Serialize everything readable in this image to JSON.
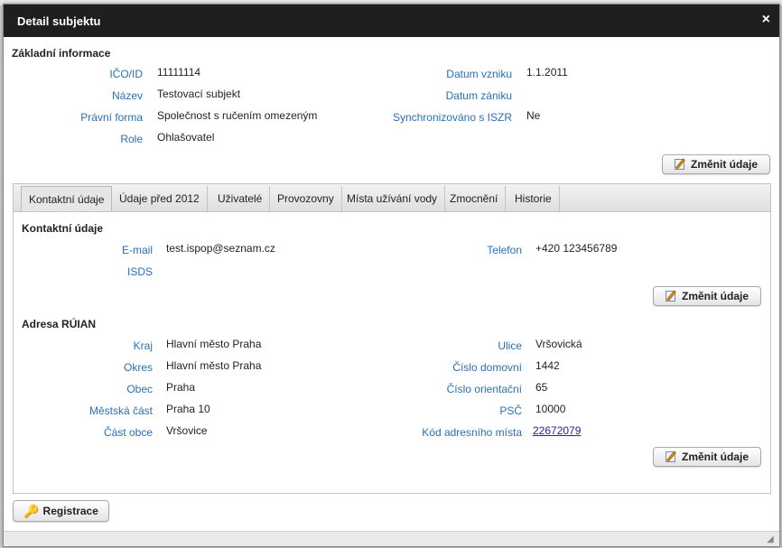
{
  "dialog": {
    "title": "Detail subjektu",
    "close_glyph": "×"
  },
  "basic": {
    "title": "Základní informace",
    "ico_label": "IČO/ID",
    "ico_value": "11111114",
    "name_label": "Název",
    "name_value": "Testovací subjekt",
    "form_label": "Právní forma",
    "form_value": "Společnost s ručením omezeným",
    "role_label": "Role",
    "role_value": "Ohlašovatel",
    "created_label": "Datum vzniku",
    "created_value": "1.1.2011",
    "ended_label": "Datum zániku",
    "ended_value": "",
    "sync_label": "Synchronizováno s ISZR",
    "sync_value": "Ne",
    "edit_button": "Změnit údaje"
  },
  "tabs": [
    {
      "label": "Kontaktní údaje",
      "active": true
    },
    {
      "label": "Údaje před 2012"
    },
    {
      "label": "Uživatelé"
    },
    {
      "label": "Provozovny"
    },
    {
      "label": "Místa užívání vody"
    },
    {
      "label": "Zmocnění"
    },
    {
      "label": "Historie"
    }
  ],
  "contact": {
    "title": "Kontaktní údaje",
    "email_label": "E-mail",
    "email_value": "test.ispop@seznam.cz",
    "isds_label": "ISDS",
    "isds_value": "",
    "phone_label": "Telefon",
    "phone_value": "+420 123456789",
    "edit_button": "Změnit údaje"
  },
  "address": {
    "title": "Adresa RÚIAN",
    "region_label": "Kraj",
    "region_value": "Hlavní město Praha",
    "district_label": "Okres",
    "district_value": "Hlavní město Praha",
    "town_label": "Obec",
    "town_value": "Praha",
    "cityPart_label": "Městská část",
    "cityPart_value": "Praha 10",
    "part_label": "Část obce",
    "part_value": "Vršovice",
    "street_label": "Ulice",
    "street_value": "Vršovická",
    "houseNo_label": "Číslo domovní",
    "houseNo_value": "1442",
    "orientNo_label": "Číslo orientační",
    "orientNo_value": "65",
    "zip_label": "PSČ",
    "zip_value": "10000",
    "code_label": "Kód adresního místa",
    "code_value": "22672079",
    "edit_button": "Změnit údaje"
  },
  "registration_button": "Registrace",
  "icons": {
    "edit": "edit-icon",
    "key": "key-icon",
    "close": "close-icon",
    "resize": "resize-grip-icon"
  }
}
